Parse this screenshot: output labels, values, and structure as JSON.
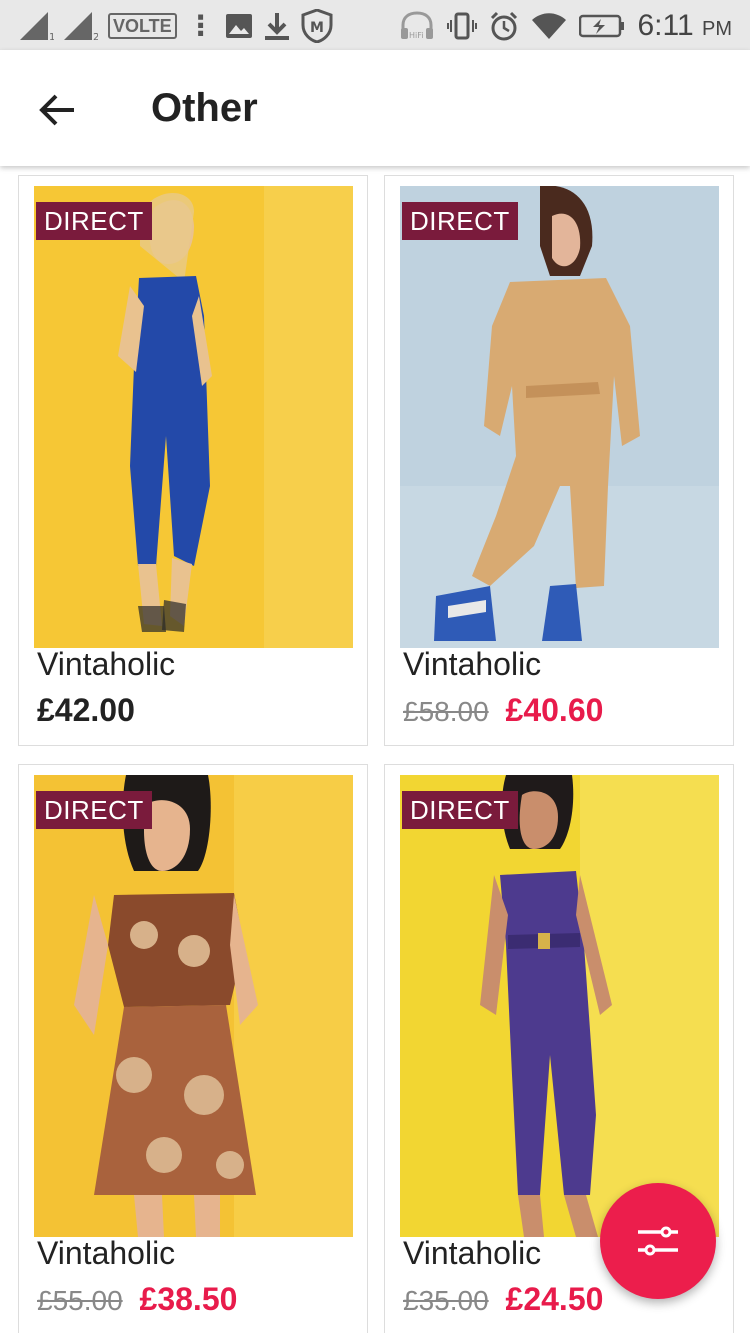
{
  "status_bar": {
    "volte": "VOLTE",
    "time": "6:11",
    "ampm": "PM",
    "icons": [
      "signal-1-icon",
      "signal-2-icon",
      "more-vert-icon",
      "image-icon",
      "download-icon",
      "shield-icon",
      "hifi-headphones-icon",
      "vibrate-icon",
      "alarm-icon",
      "wifi-icon",
      "battery-charging-icon"
    ]
  },
  "app_bar": {
    "title": "Other",
    "back_icon": "arrow-back-icon"
  },
  "badge_label": "DIRECT",
  "products": [
    {
      "brand": "Vintaholic",
      "price": "£42.00",
      "original_price": "",
      "sale_price": "",
      "image": "blue-jumpsuit-on-yellow"
    },
    {
      "brand": "Vintaholic",
      "price": "",
      "original_price": "£58.00",
      "sale_price": "£40.60",
      "image": "tan-ski-suit-on-blue"
    },
    {
      "brand": "Vintaholic",
      "price": "",
      "original_price": "£55.00",
      "sale_price": "£38.50",
      "image": "floral-two-piece-on-yellow"
    },
    {
      "brand": "Vintaholic",
      "price": "",
      "original_price": "£35.00",
      "sale_price": "£24.50",
      "image": "purple-jumpsuit-on-yellow"
    }
  ],
  "fab": {
    "icon": "filter-sliders-icon"
  },
  "colors": {
    "badge": "#7a1b3c",
    "sale": "#e81b4b",
    "fab": "#ec1e4c",
    "status_bar": "#e8e8e8"
  }
}
